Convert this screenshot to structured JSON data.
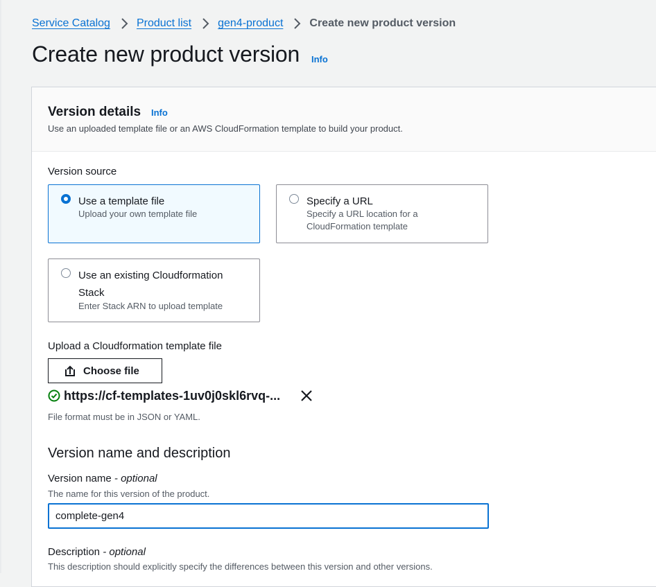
{
  "breadcrumb": {
    "items": [
      "Service Catalog",
      "Product list",
      "gen4-product"
    ],
    "current": "Create new product version"
  },
  "page": {
    "title": "Create new product version",
    "info": "Info"
  },
  "version_details": {
    "title": "Version details",
    "info": "Info",
    "description": "Use an uploaded template file or an AWS CloudFormation template to build your product."
  },
  "version_source": {
    "label": "Version source",
    "options": [
      {
        "title": "Use a template file",
        "desc": "Upload your own template file",
        "selected": true
      },
      {
        "title": "Specify a URL",
        "desc_lines": [
          "Specify a URL location for a",
          "CloudFormation template"
        ],
        "selected": false
      },
      {
        "title_lines": [
          "Use an existing Cloudformation",
          "Stack"
        ],
        "desc": "Enter Stack ARN to upload template",
        "selected": false
      }
    ]
  },
  "upload": {
    "label": "Upload a Cloudformation template file",
    "button_label": "Choose file",
    "file_name": "https://cf-templates-1uv0j0skl6rvq-...",
    "format_hint": "File format must be in JSON or YAML."
  },
  "version_name_section": {
    "title": "Version name and description",
    "name_label": "Version name",
    "optional": "- optional",
    "name_hint": "The name for this version of the product.",
    "name_value": "complete-gen4",
    "description_label": "Description",
    "description_hint": "This description should explicitly specify the differences between this version and other versions."
  },
  "icons": {
    "separator": "chevron-right-icon",
    "upload": "upload-icon",
    "success": "check-circle-icon",
    "remove": "close-icon"
  },
  "colors": {
    "link": "#0972d3",
    "success": "#037f0c",
    "selected_bg": "#f1faff",
    "page_bg": "#f2f3f3"
  }
}
